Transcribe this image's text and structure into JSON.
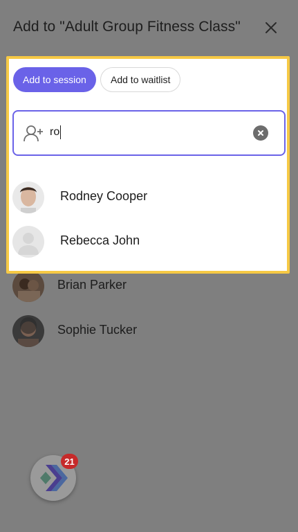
{
  "header": {
    "title": "Add to \"Adult Group Fitness Class\"",
    "close_icon": "close-icon"
  },
  "tabs": {
    "add_to_session": "Add to session",
    "add_to_waitlist": "Add to waitlist"
  },
  "search": {
    "value": "ro",
    "icon": "add-user-icon",
    "clear_icon": "clear-icon"
  },
  "results": [
    {
      "name": "Rodney Cooper"
    },
    {
      "name": "Rebecca John"
    }
  ],
  "background_list": [
    {
      "name": "Brian Parker"
    },
    {
      "name": "Sophie Tucker"
    }
  ],
  "notifications": {
    "badge_count": "21"
  },
  "colors": {
    "accent": "#6a62e8",
    "highlight_border": "#f6c945",
    "overlay": "#7f7f7f",
    "badge": "#c62a2a"
  }
}
